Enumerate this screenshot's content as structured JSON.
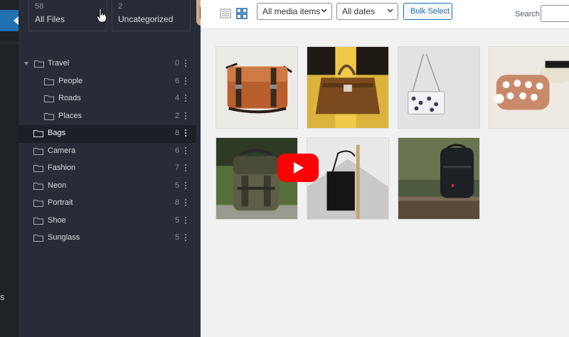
{
  "folder_summary": {
    "all_files": {
      "count": "58",
      "label": "All Files"
    },
    "uncategorized": {
      "count": "2",
      "label": "Uncategorized"
    }
  },
  "folders": [
    {
      "name": "Travel",
      "count": "0",
      "expanded": true
    },
    {
      "name": "People",
      "count": "6",
      "child": true
    },
    {
      "name": "Roads",
      "count": "4",
      "child": true
    },
    {
      "name": "Places",
      "count": "2",
      "child": true
    },
    {
      "name": "Bags",
      "count": "8",
      "active": true
    },
    {
      "name": "Camera",
      "count": "6"
    },
    {
      "name": "Fashion",
      "count": "7"
    },
    {
      "name": "Neon",
      "count": "5"
    },
    {
      "name": "Portrait",
      "count": "8"
    },
    {
      "name": "Shoe",
      "count": "5"
    },
    {
      "name": "Sunglass",
      "count": "5"
    }
  ],
  "toolbar": {
    "media_filter": "All media items",
    "date_filter": "All dates",
    "bulk_select": "Bulk Select",
    "search_label": "Search",
    "search_value": ""
  },
  "media_items": [
    "brown-leather-messenger-bag",
    "brown-suede-handbag-on-yellow",
    "white-embroidered-chain-purse",
    "floral-studded-crossbody-bag",
    "olive-green-backpack",
    "black-tote-bag-on-hook",
    "black-camera-backpack-on-bench"
  ],
  "colors": {
    "accent": "#2271b1",
    "panel": "#272c37",
    "youtube_red": "#ff0000"
  }
}
